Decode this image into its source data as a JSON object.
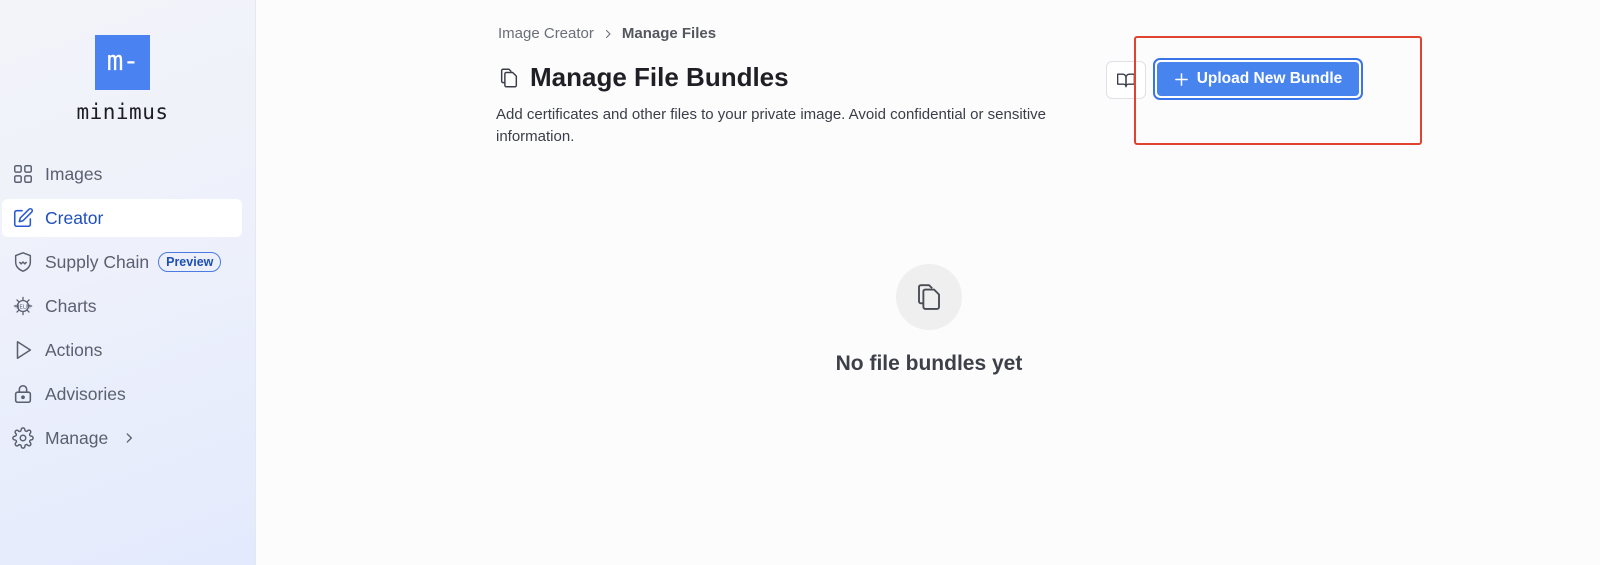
{
  "brand": {
    "logo_mark": "m-",
    "name": "minimus",
    "accent": "#4a82f1"
  },
  "sidebar": {
    "items": [
      {
        "label": "Images",
        "icon": "grid-icon"
      },
      {
        "label": "Creator",
        "icon": "edit-icon",
        "active": true
      },
      {
        "label": "Supply Chain",
        "icon": "shield-icon",
        "badge": "Preview"
      },
      {
        "label": "Charts",
        "icon": "helm-icon"
      },
      {
        "label": "Actions",
        "icon": "play-icon"
      },
      {
        "label": "Advisories",
        "icon": "lock-icon"
      },
      {
        "label": "Manage",
        "icon": "gear-icon"
      }
    ]
  },
  "breadcrumb": {
    "parent": "Image Creator",
    "current": "Manage Files"
  },
  "header": {
    "title": "Manage File Bundles",
    "description": "Add certificates and other files to your private image. Avoid confidential or sensitive information.",
    "upload_label": "Upload New Bundle"
  },
  "empty_state": {
    "text": "No file bundles yet"
  },
  "colors": {
    "primary_button": "#4884ee",
    "highlight": "#e0432f",
    "active_nav_text": "#1f4fb8"
  }
}
